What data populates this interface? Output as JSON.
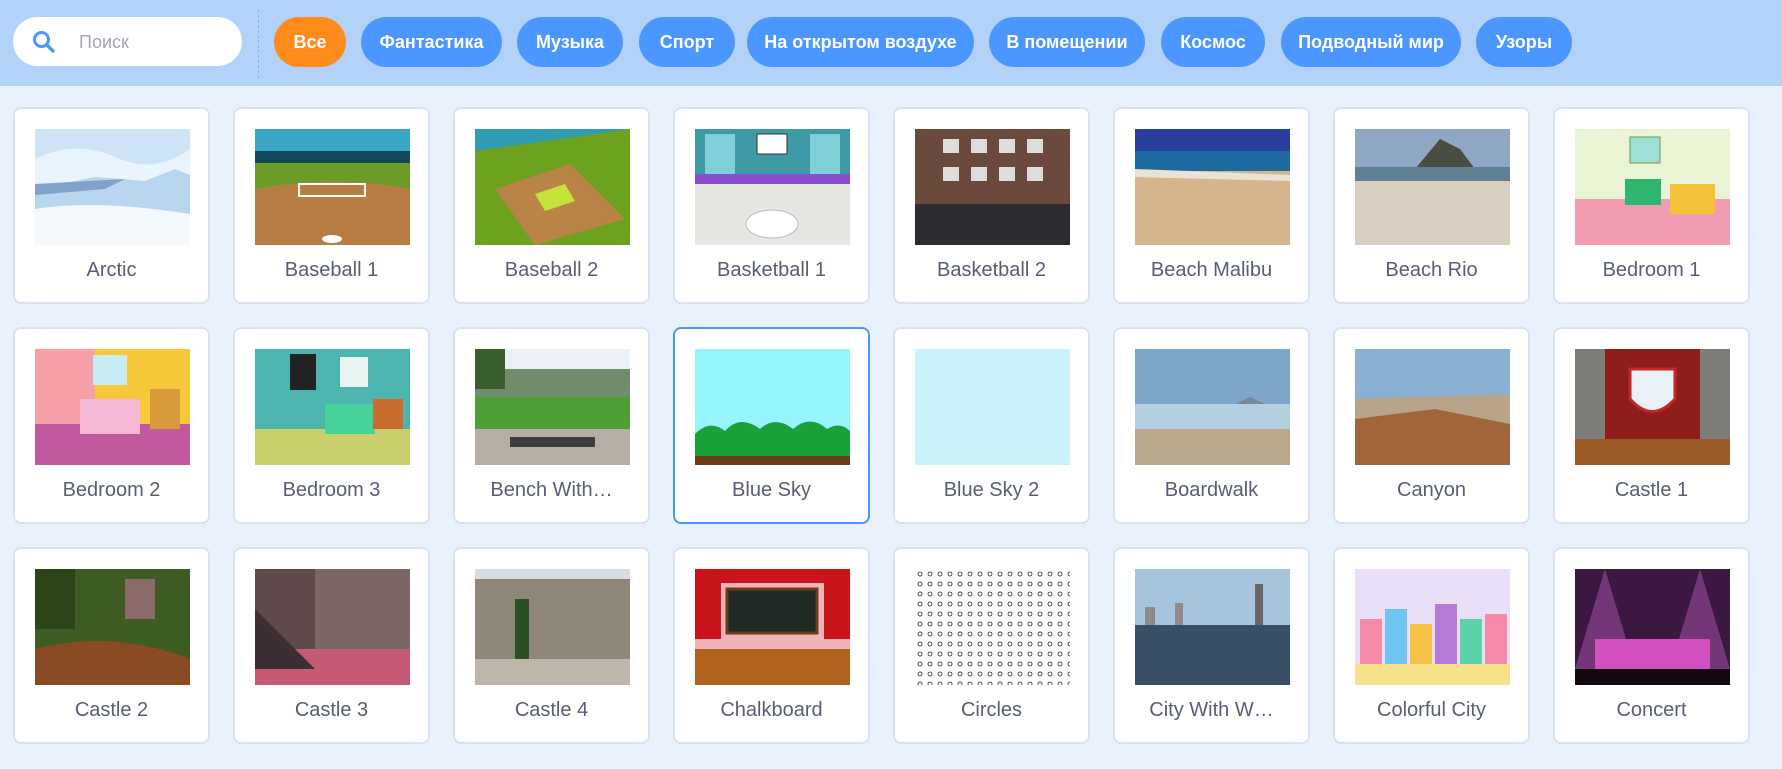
{
  "search": {
    "placeholder": "Поиск",
    "value": "",
    "icon": "search-icon"
  },
  "colors": {
    "topbar": "#b3d2fa",
    "tag": "#4c97ff",
    "tag_active": "#ff8c1a",
    "selected_border": "#4c97ff",
    "label": "#575e75",
    "background": "#e9f1fc"
  },
  "tags": [
    {
      "label": "Все",
      "active": true
    },
    {
      "label": "Фантастика",
      "active": false
    },
    {
      "label": "Музыка",
      "active": false
    },
    {
      "label": "Спорт",
      "active": false
    },
    {
      "label": "На открытом воздухе",
      "active": false
    },
    {
      "label": "В помещении",
      "active": false
    },
    {
      "label": "Космос",
      "active": false
    },
    {
      "label": "Подводный мир",
      "active": false
    },
    {
      "label": "Узоры",
      "active": false
    }
  ],
  "backdrops": [
    {
      "name": "Arctic",
      "thumb": "arctic"
    },
    {
      "name": "Baseball 1",
      "thumb": "baseball1"
    },
    {
      "name": "Baseball 2",
      "thumb": "baseball2"
    },
    {
      "name": "Basketball 1",
      "thumb": "basketball1"
    },
    {
      "name": "Basketball 2",
      "thumb": "basketball2"
    },
    {
      "name": "Beach Malibu",
      "thumb": "beach-malibu"
    },
    {
      "name": "Beach Rio",
      "thumb": "beach-rio"
    },
    {
      "name": "Bedroom 1",
      "thumb": "bedroom1"
    },
    {
      "name": "Bedroom 2",
      "thumb": "bedroom2"
    },
    {
      "name": "Bedroom 3",
      "thumb": "bedroom3"
    },
    {
      "name": "Bench With…",
      "thumb": "bench"
    },
    {
      "name": "Blue Sky",
      "thumb": "blue-sky",
      "selected": true
    },
    {
      "name": "Blue Sky 2",
      "thumb": "blue-sky2"
    },
    {
      "name": "Boardwalk",
      "thumb": "boardwalk"
    },
    {
      "name": "Canyon",
      "thumb": "canyon"
    },
    {
      "name": "Castle 1",
      "thumb": "castle1"
    },
    {
      "name": "Castle 2",
      "thumb": "castle2"
    },
    {
      "name": "Castle 3",
      "thumb": "castle3"
    },
    {
      "name": "Castle 4",
      "thumb": "castle4"
    },
    {
      "name": "Chalkboard",
      "thumb": "chalkboard"
    },
    {
      "name": "Circles",
      "thumb": "circles"
    },
    {
      "name": "City With W…",
      "thumb": "city"
    },
    {
      "name": "Colorful City",
      "thumb": "colorful-city"
    },
    {
      "name": "Concert",
      "thumb": "concert"
    }
  ]
}
